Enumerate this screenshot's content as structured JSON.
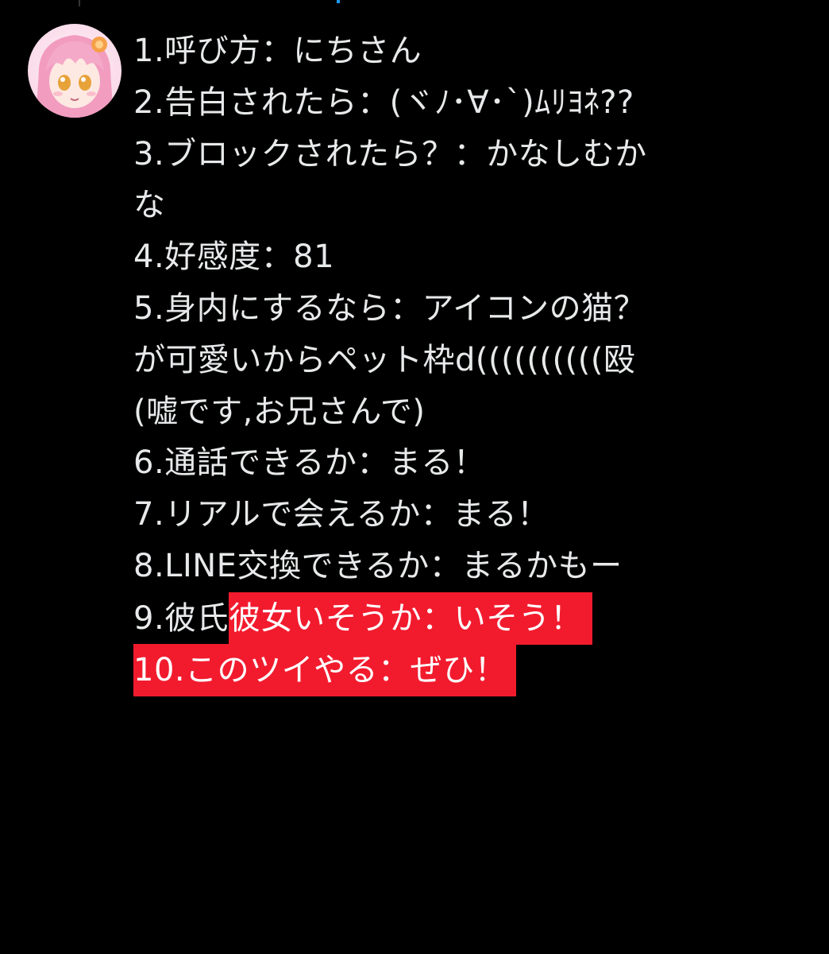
{
  "post": {
    "lines": [
      "1.呼び方：にちさん",
      "2.告白されたら：(ヾﾉ･∀･`)ﾑﾘﾖﾈ??",
      "3.ブロックされたら？：かなしむか",
      "な",
      "4.好感度：81",
      "5.身内にするなら：アイコンの猫？",
      "が可愛いからペット枠d((((((((((殴",
      "(嘘です,お兄さんで)",
      "6.通話できるか：まる！",
      "7.リアルで会えるか：まる！",
      "8.LINE交換できるか：まるかもー"
    ],
    "line9_plain": "9.彼氏",
    "line9_highlight": "彼女いそうか：いそう！",
    "line10_highlight": "10.このツイやる：ぜひ！"
  },
  "colors": {
    "background": "#000000",
    "text": "#e7e9ea",
    "highlight": "#f21b2e",
    "accent": "#1d9bf0"
  },
  "icons": {
    "avatar": "pink-haired-anime-avatar"
  }
}
